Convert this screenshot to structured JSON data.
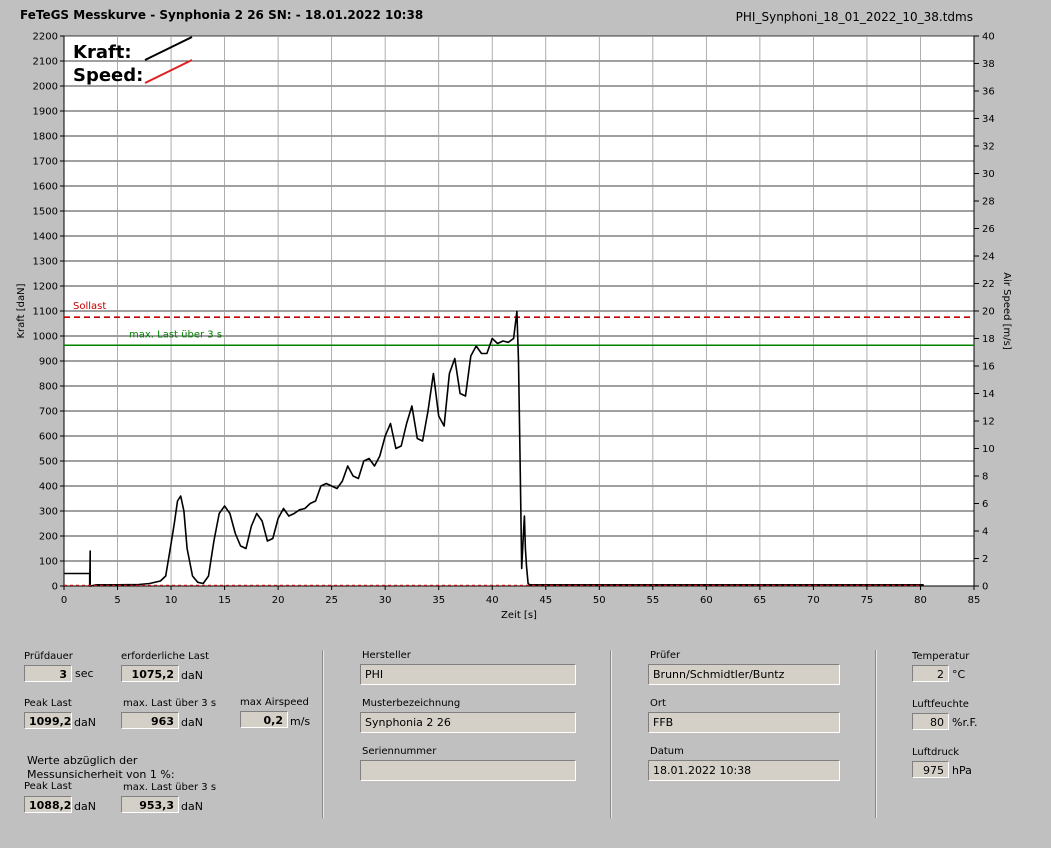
{
  "header": {
    "title": "FeTeGS Messkurve - Synphonia 2 26  SN:  - 18.01.2022 10:38",
    "file": "PHI_Synphoni_18_01_2022_10_38.tdms"
  },
  "chart_data": {
    "type": "line",
    "xlabel": "Zeit [s]",
    "ylabel": "Kraft [daN]",
    "y2label": "Air Speed [m/s]",
    "xlim": [
      0,
      85
    ],
    "ylim": [
      0,
      2200
    ],
    "y2lim": [
      0,
      40
    ],
    "xticks": [
      "0",
      "5",
      "10",
      "15",
      "20",
      "25",
      "30",
      "35",
      "40",
      "45",
      "50",
      "55",
      "60",
      "65",
      "70",
      "75",
      "80",
      "85"
    ],
    "yticks": [
      "0",
      "100",
      "200",
      "300",
      "400",
      "500",
      "600",
      "700",
      "800",
      "900",
      "1000",
      "1100",
      "1200",
      "1300",
      "1400",
      "1500",
      "1600",
      "1700",
      "1800",
      "1900",
      "2000",
      "2100",
      "2200"
    ],
    "y2ticks": [
      "0",
      "2",
      "4",
      "6",
      "8",
      "10",
      "12",
      "14",
      "16",
      "18",
      "20",
      "22",
      "24",
      "26",
      "28",
      "30",
      "32",
      "34",
      "36",
      "38",
      "40"
    ],
    "grid": true,
    "legend": {
      "position": "top-left",
      "entries": [
        {
          "label": "Kraft:",
          "color": "#000000"
        },
        {
          "label": "Speed:",
          "color": "#e02020"
        }
      ]
    },
    "reference_lines": [
      {
        "label": "Sollast",
        "y": 1075.2,
        "color": "#c00000",
        "style": "dashed"
      },
      {
        "label": "max. Last über  3 s",
        "y": 963,
        "color": "#008000",
        "style": "solid"
      }
    ],
    "series": [
      {
        "name": "Kraft",
        "axis": "left",
        "color": "#000000",
        "x": [
          0,
          2.4,
          2.4,
          2.45,
          2.45,
          2.5,
          3,
          5,
          7,
          8,
          9,
          9.5,
          10,
          10.3,
          10.6,
          10.9,
          11.2,
          11.5,
          12,
          12.5,
          13,
          13.5,
          14,
          14.5,
          15,
          15.5,
          16,
          16.5,
          17,
          17.5,
          18,
          18.5,
          19,
          19.5,
          20,
          20.5,
          21,
          21.5,
          22,
          22.5,
          23,
          23.5,
          24,
          24.5,
          25,
          25.5,
          26,
          26.5,
          27,
          27.5,
          28,
          28.5,
          29,
          29.5,
          30,
          30.5,
          31,
          31.5,
          32,
          32.5,
          33,
          33.5,
          34,
          34.5,
          35,
          35.5,
          36,
          36.5,
          37,
          37.5,
          38,
          38.5,
          39,
          39.5,
          40,
          40.5,
          41,
          41.5,
          42,
          42.3,
          42.45,
          42.6,
          42.75,
          42.9,
          43,
          43.1,
          43.2,
          43.35,
          43.5,
          44,
          45,
          50,
          55,
          60,
          65,
          70,
          75,
          80,
          80.3
        ],
        "y": [
          50,
          50,
          0,
          140,
          0,
          0,
          5,
          5,
          6,
          10,
          20,
          40,
          170,
          250,
          340,
          360,
          300,
          150,
          40,
          15,
          10,
          40,
          180,
          290,
          320,
          290,
          210,
          160,
          150,
          240,
          290,
          260,
          180,
          190,
          270,
          310,
          280,
          290,
          305,
          310,
          330,
          340,
          400,
          410,
          400,
          390,
          420,
          480,
          440,
          430,
          500,
          510,
          480,
          520,
          600,
          650,
          550,
          560,
          650,
          720,
          590,
          580,
          700,
          850,
          680,
          640,
          850,
          910,
          770,
          760,
          920,
          960,
          930,
          930,
          990,
          970,
          980,
          975,
          990,
          1099,
          900,
          500,
          70,
          200,
          280,
          150,
          80,
          10,
          5,
          5,
          5,
          5,
          5,
          5,
          5,
          5,
          5,
          5,
          5
        ]
      },
      {
        "name": "Speed",
        "axis": "right",
        "color": "#e02020",
        "x": [
          0,
          10,
          20,
          30,
          40,
          43,
          50,
          80
        ],
        "y": [
          0.05,
          0.05,
          0.05,
          0.05,
          0.05,
          0.05,
          0.05,
          0.05
        ]
      }
    ]
  },
  "panel": {
    "pruefdauer": {
      "label": "Prüfdauer",
      "value": "3",
      "unit": "sec"
    },
    "erforderliche_last": {
      "label": "erforderliche Last",
      "value": "1075,2",
      "unit": "daN"
    },
    "peak_last": {
      "label": "Peak Last",
      "value": "1099,2",
      "unit": "daN"
    },
    "max_last": {
      "label": "max. Last über  3 s",
      "value": "963",
      "unit": "daN"
    },
    "max_airspeed": {
      "label": "max Airspeed",
      "value": "0,2",
      "unit": "m/s"
    },
    "note_line1": "Werte abzüglich der",
    "note_line2": "Messunsicherheit von 1  %:",
    "peak_last2": {
      "label": "Peak Last",
      "value": "1088,2",
      "unit": "daN"
    },
    "max_last2": {
      "label": "max. Last über  3 s",
      "value": "953,3",
      "unit": "daN"
    },
    "hersteller": {
      "label": "Hersteller",
      "value": "PHI"
    },
    "musterbezeichnung": {
      "label": "Musterbezeichnung",
      "value": "Synphonia 2 26"
    },
    "seriennummer": {
      "label": "Seriennummer",
      "value": ""
    },
    "pruefer": {
      "label": "Prüfer",
      "value": "Brunn/Schmidtler/Buntz"
    },
    "ort": {
      "label": "Ort",
      "value": "FFB"
    },
    "datum": {
      "label": "Datum",
      "value": "18.01.2022 10:38"
    },
    "temperatur": {
      "label": "Temperatur",
      "value": "2",
      "unit": "°C"
    },
    "luftfeuchte": {
      "label": "Luftfeuchte",
      "value": "80",
      "unit": "%r.F."
    },
    "luftdruck": {
      "label": "Luftdruck",
      "value": "975",
      "unit": "hPa"
    }
  }
}
